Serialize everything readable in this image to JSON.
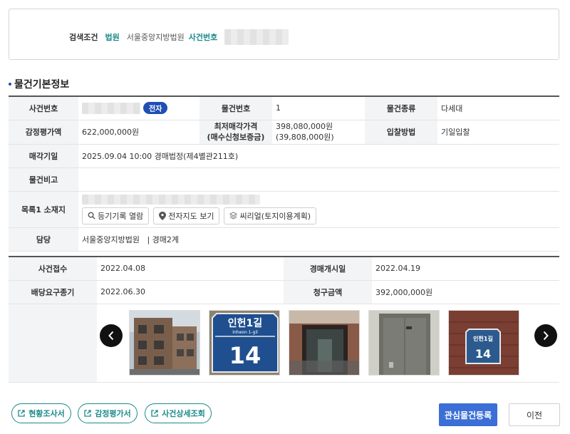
{
  "search": {
    "label": "검색조건",
    "court_key": "법원",
    "court_value": "서울중앙지방법원",
    "case_key": "사건번호"
  },
  "section_title": "물건기본정보",
  "basic": {
    "case_no_label": "사건번호",
    "e_badge": "전자",
    "item_no_label": "물건번호",
    "item_no": "1",
    "item_type_label": "물건종류",
    "item_type": "다세대",
    "appraisal_label": "감정평가액",
    "appraisal": "622,000,000원",
    "min_price_label_1": "최저매각가격",
    "min_price_label_2": "(매수신청보증금)",
    "min_price": "398,080,000원",
    "deposit": "(39,808,000원)",
    "bid_method_label": "입찰방법",
    "bid_method": "기일입찰",
    "sale_date_label": "매각기일",
    "sale_date": "2025.09.04 10:00 경매법정(제4별관211호)",
    "remarks_label": "물건비고",
    "remarks": "",
    "location_label": "목록1 소재지",
    "btn_registry": "등기기록 열람",
    "btn_map": "전자지도 보기",
    "btn_seereal": "씨리얼(토지이용계획)",
    "charge_label": "담당",
    "charge": "서울중앙지방법원   | 경매2계"
  },
  "case_info": {
    "receipt_label": "사건접수",
    "receipt": "2022.04.08",
    "start_label": "경매개시일",
    "start": "2022.04.19",
    "dividend_label": "배당요구종기",
    "dividend": "2022.06.30",
    "claim_label": "청구금액",
    "claim": "392,000,000원"
  },
  "photos": {
    "sign_main": "인헌1길",
    "sign_sub": "Inheon 1-gil",
    "sign_num": "14",
    "sign2_main": "인헌1길",
    "sign2_num": "14"
  },
  "bottom": {
    "btn_survey": "현황조사서",
    "btn_appraisal": "감정평가서",
    "btn_case_detail": "사건상세조회",
    "btn_register": "관심물건등록",
    "btn_prev": "이전"
  },
  "colors": {
    "accent": "#1f4fb4",
    "teal": "#1a8a8a",
    "primary_button": "#3b6fd6"
  }
}
